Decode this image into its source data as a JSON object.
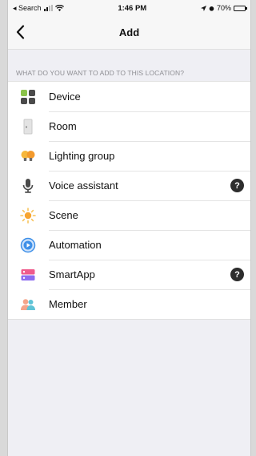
{
  "status_bar": {
    "back_app": "Search",
    "time": "1:46 PM",
    "battery": "70%",
    "battery_level": 0.7
  },
  "nav": {
    "title": "Add",
    "back_icon": "chevron-left-icon"
  },
  "section": {
    "header": "WHAT DO YOU WANT TO ADD TO THIS LOCATION?"
  },
  "items": [
    {
      "label": "Device",
      "icon": "device-icon",
      "help": false
    },
    {
      "label": "Room",
      "icon": "room-door-icon",
      "help": false
    },
    {
      "label": "Lighting group",
      "icon": "lighting-group-icon",
      "help": false
    },
    {
      "label": "Voice assistant",
      "icon": "microphone-icon",
      "help": true
    },
    {
      "label": "Scene",
      "icon": "sun-icon",
      "help": false
    },
    {
      "label": "Automation",
      "icon": "automation-icon",
      "help": false
    },
    {
      "label": "SmartApp",
      "icon": "smartapp-icon",
      "help": true
    },
    {
      "label": "Member",
      "icon": "member-icon",
      "help": false
    }
  ],
  "help_glyph": "?",
  "colors": {
    "background": "#efeff4",
    "automation_blue": "#3d8fe8",
    "scene_orange": "#f7a531"
  }
}
